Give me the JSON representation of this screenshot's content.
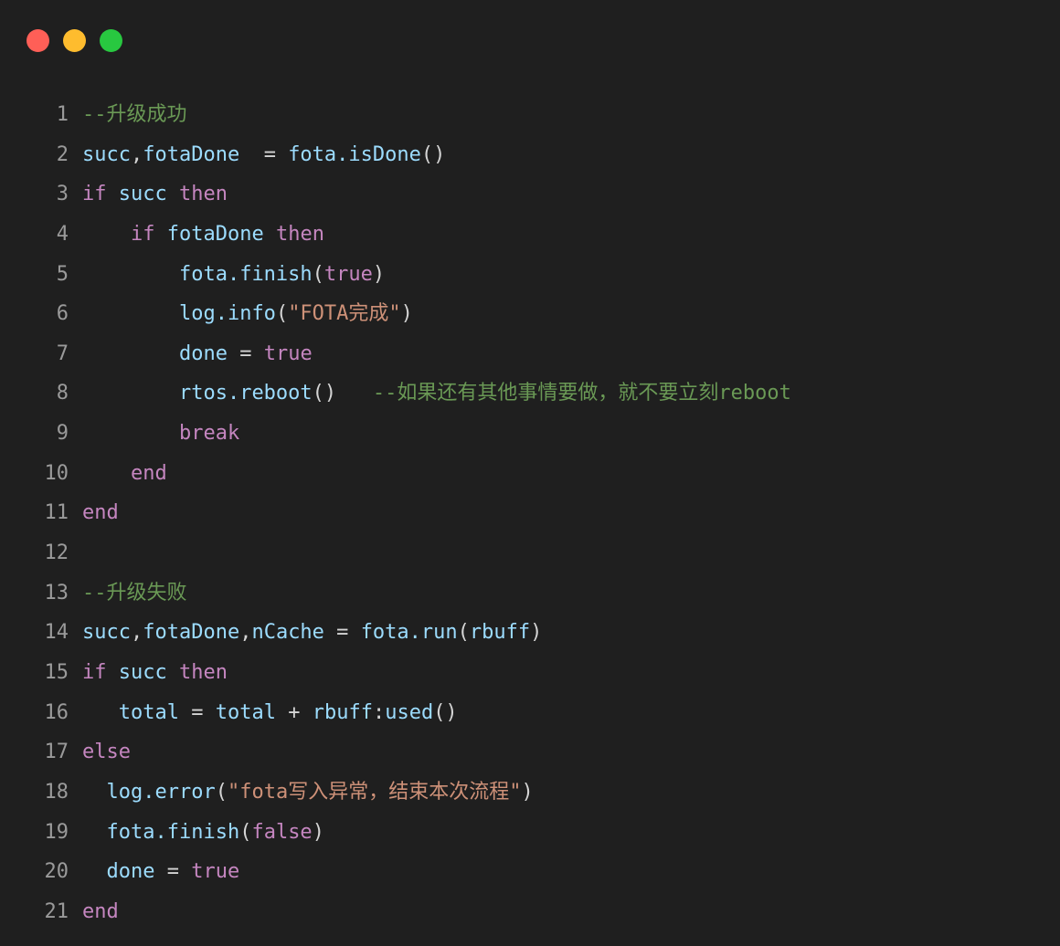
{
  "window": {
    "buttons": [
      {
        "name": "close",
        "color": "#ff5f57"
      },
      {
        "name": "minimize",
        "color": "#febc2e"
      },
      {
        "name": "maximize",
        "color": "#28c840"
      }
    ]
  },
  "colors": {
    "background": "#1f1f1f",
    "line_number": "#9a9a9a",
    "keyword": "#c586c0",
    "comment": "#6a9955",
    "string": "#ce9178",
    "identifier": "#9cdcfe",
    "punctuation": "#d4d4d4"
  },
  "code_lines": [
    {
      "n": "1",
      "tokens": [
        {
          "t": "--升级成功",
          "c": "cm"
        }
      ]
    },
    {
      "n": "2",
      "tokens": [
        {
          "t": "succ",
          "c": "vr"
        },
        {
          "t": ",",
          "c": "pl"
        },
        {
          "t": "fotaDone",
          "c": "vr"
        },
        {
          "t": "  = ",
          "c": "pl"
        },
        {
          "t": "fota.isDone",
          "c": "vr"
        },
        {
          "t": "()",
          "c": "pl"
        }
      ]
    },
    {
      "n": "3",
      "tokens": [
        {
          "t": "if",
          "c": "kw"
        },
        {
          "t": " ",
          "c": "pl"
        },
        {
          "t": "succ",
          "c": "vr"
        },
        {
          "t": " ",
          "c": "pl"
        },
        {
          "t": "then",
          "c": "kw"
        }
      ]
    },
    {
      "n": "4",
      "tokens": [
        {
          "t": "    ",
          "c": "pl"
        },
        {
          "t": "if",
          "c": "kw"
        },
        {
          "t": " ",
          "c": "pl"
        },
        {
          "t": "fotaDone",
          "c": "vr"
        },
        {
          "t": " ",
          "c": "pl"
        },
        {
          "t": "then",
          "c": "kw"
        }
      ]
    },
    {
      "n": "5",
      "tokens": [
        {
          "t": "        ",
          "c": "pl"
        },
        {
          "t": "fota.finish",
          "c": "vr"
        },
        {
          "t": "(",
          "c": "pl"
        },
        {
          "t": "true",
          "c": "kw"
        },
        {
          "t": ")",
          "c": "pl"
        }
      ]
    },
    {
      "n": "6",
      "tokens": [
        {
          "t": "        ",
          "c": "pl"
        },
        {
          "t": "log.info",
          "c": "vr"
        },
        {
          "t": "(",
          "c": "pl"
        },
        {
          "t": "\"FOTA完成\"",
          "c": "st"
        },
        {
          "t": ")",
          "c": "pl"
        }
      ]
    },
    {
      "n": "7",
      "tokens": [
        {
          "t": "        ",
          "c": "pl"
        },
        {
          "t": "done",
          "c": "vr"
        },
        {
          "t": " = ",
          "c": "pl"
        },
        {
          "t": "true",
          "c": "kw"
        }
      ]
    },
    {
      "n": "8",
      "tokens": [
        {
          "t": "        ",
          "c": "pl"
        },
        {
          "t": "rtos.reboot",
          "c": "vr"
        },
        {
          "t": "()   ",
          "c": "pl"
        },
        {
          "t": "--如果还有其他事情要做，就不要立刻reboot",
          "c": "cm"
        }
      ]
    },
    {
      "n": "9",
      "tokens": [
        {
          "t": "        ",
          "c": "pl"
        },
        {
          "t": "break",
          "c": "kw"
        }
      ]
    },
    {
      "n": "10",
      "tokens": [
        {
          "t": "    ",
          "c": "pl"
        },
        {
          "t": "end",
          "c": "kw"
        }
      ]
    },
    {
      "n": "11",
      "tokens": [
        {
          "t": "end",
          "c": "kw"
        }
      ]
    },
    {
      "n": "12",
      "tokens": []
    },
    {
      "n": "13",
      "tokens": [
        {
          "t": "--升级失败",
          "c": "cm"
        }
      ]
    },
    {
      "n": "14",
      "tokens": [
        {
          "t": "succ",
          "c": "vr"
        },
        {
          "t": ",",
          "c": "pl"
        },
        {
          "t": "fotaDone",
          "c": "vr"
        },
        {
          "t": ",",
          "c": "pl"
        },
        {
          "t": "nCache",
          "c": "vr"
        },
        {
          "t": " = ",
          "c": "pl"
        },
        {
          "t": "fota.run",
          "c": "vr"
        },
        {
          "t": "(",
          "c": "pl"
        },
        {
          "t": "rbuff",
          "c": "vr"
        },
        {
          "t": ")",
          "c": "pl"
        }
      ]
    },
    {
      "n": "15",
      "tokens": [
        {
          "t": "if",
          "c": "kw"
        },
        {
          "t": " ",
          "c": "pl"
        },
        {
          "t": "succ",
          "c": "vr"
        },
        {
          "t": " ",
          "c": "pl"
        },
        {
          "t": "then",
          "c": "kw"
        }
      ]
    },
    {
      "n": "16",
      "tokens": [
        {
          "t": "   ",
          "c": "pl"
        },
        {
          "t": "total",
          "c": "vr"
        },
        {
          "t": " = ",
          "c": "pl"
        },
        {
          "t": "total",
          "c": "vr"
        },
        {
          "t": " + ",
          "c": "pl"
        },
        {
          "t": "rbuff",
          "c": "vr"
        },
        {
          "t": ":",
          "c": "pl"
        },
        {
          "t": "used",
          "c": "vr"
        },
        {
          "t": "()",
          "c": "pl"
        }
      ]
    },
    {
      "n": "17",
      "tokens": [
        {
          "t": "else",
          "c": "kw"
        }
      ]
    },
    {
      "n": "18",
      "tokens": [
        {
          "t": "  ",
          "c": "pl"
        },
        {
          "t": "log.error",
          "c": "vr"
        },
        {
          "t": "(",
          "c": "pl"
        },
        {
          "t": "\"fota写入异常，结束本次流程\"",
          "c": "st"
        },
        {
          "t": ")",
          "c": "pl"
        }
      ]
    },
    {
      "n": "19",
      "tokens": [
        {
          "t": "  ",
          "c": "pl"
        },
        {
          "t": "fota.finish",
          "c": "vr"
        },
        {
          "t": "(",
          "c": "pl"
        },
        {
          "t": "false",
          "c": "kw"
        },
        {
          "t": ")",
          "c": "pl"
        }
      ]
    },
    {
      "n": "20",
      "tokens": [
        {
          "t": "  ",
          "c": "pl"
        },
        {
          "t": "done",
          "c": "vr"
        },
        {
          "t": " = ",
          "c": "pl"
        },
        {
          "t": "true",
          "c": "kw"
        }
      ]
    },
    {
      "n": "21",
      "tokens": [
        {
          "t": "end",
          "c": "kw"
        }
      ]
    }
  ]
}
